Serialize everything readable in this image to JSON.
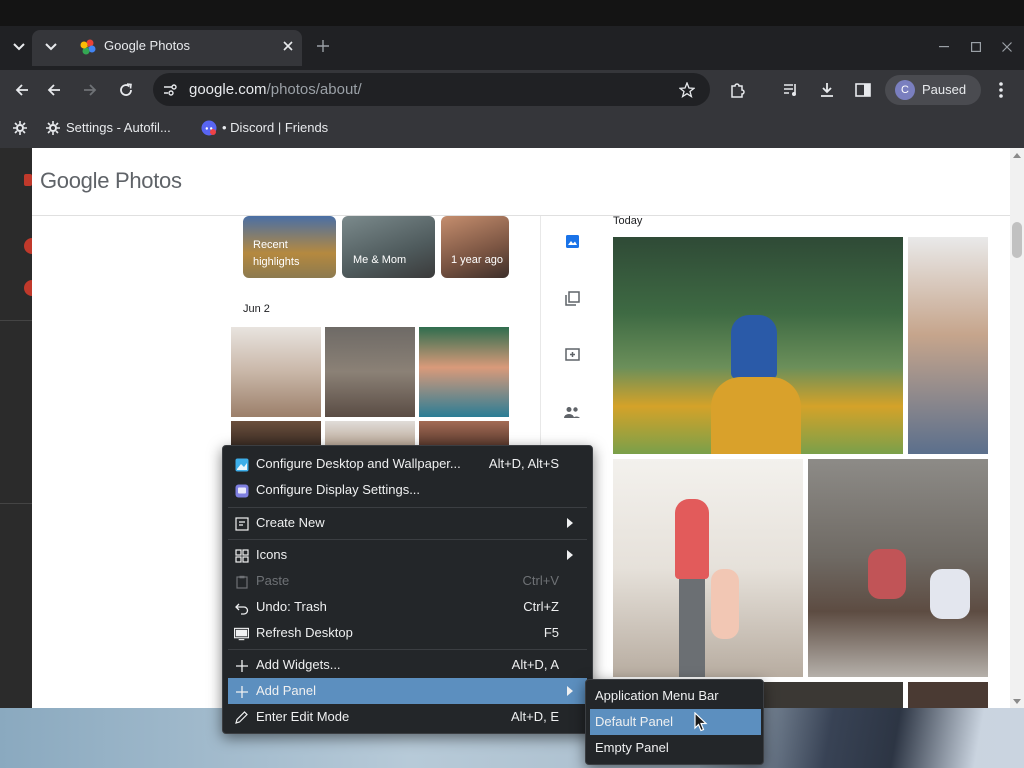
{
  "browser": {
    "tab_title": "Google Photos",
    "url_host": "google.com",
    "url_path": "/photos/about/",
    "profile_initial": "C",
    "profile_status": "Paused",
    "bookmarks": [
      {
        "label": "Settings - Autofil..."
      },
      {
        "label": "• Discord | Friends"
      }
    ]
  },
  "page": {
    "logo_google": "Google",
    "logo_photos": "Photos",
    "phone": {
      "highlights": [
        "Recent highlights",
        "Me & Mom",
        "1 year ago"
      ],
      "date_heading": "Jun 2"
    },
    "tablet": {
      "date_heading": "Today"
    }
  },
  "context_menu": {
    "items": [
      {
        "label": "Configure Desktop and Wallpaper...",
        "shortcut": "Alt+D, Alt+S",
        "icon": "wallpaper-icon"
      },
      {
        "label": "Configure Display Settings...",
        "shortcut": "",
        "icon": "display-icon"
      },
      {
        "label": "Create New",
        "shortcut": "",
        "icon": "create-new-icon",
        "submenu": true
      },
      {
        "label": "Icons",
        "shortcut": "",
        "icon": "grid-icon",
        "submenu": true
      },
      {
        "label": "Paste",
        "shortcut": "Ctrl+V",
        "icon": "paste-icon",
        "disabled": true
      },
      {
        "label": "Undo: Trash",
        "shortcut": "Ctrl+Z",
        "icon": "undo-icon"
      },
      {
        "label": "Refresh Desktop",
        "shortcut": "F5",
        "icon": "refresh-desktop-icon"
      },
      {
        "label": "Add Widgets...",
        "shortcut": "Alt+D, A",
        "icon": "plus-icon"
      },
      {
        "label": "Add Panel",
        "shortcut": "",
        "icon": "plus-icon",
        "submenu": true,
        "highlighted": true
      },
      {
        "label": "Enter Edit Mode",
        "shortcut": "Alt+D, E",
        "icon": "pencil-icon"
      }
    ]
  },
  "submenu": {
    "items": [
      {
        "label": "Application Menu Bar"
      },
      {
        "label": "Default Panel",
        "highlighted": true
      },
      {
        "label": "Empty Panel"
      }
    ]
  },
  "colors": {
    "menu_bg": "#232629",
    "menu_highlight": "#5c8fbf",
    "browser_toolbar": "#35363a",
    "browser_tabbar": "#202124"
  }
}
